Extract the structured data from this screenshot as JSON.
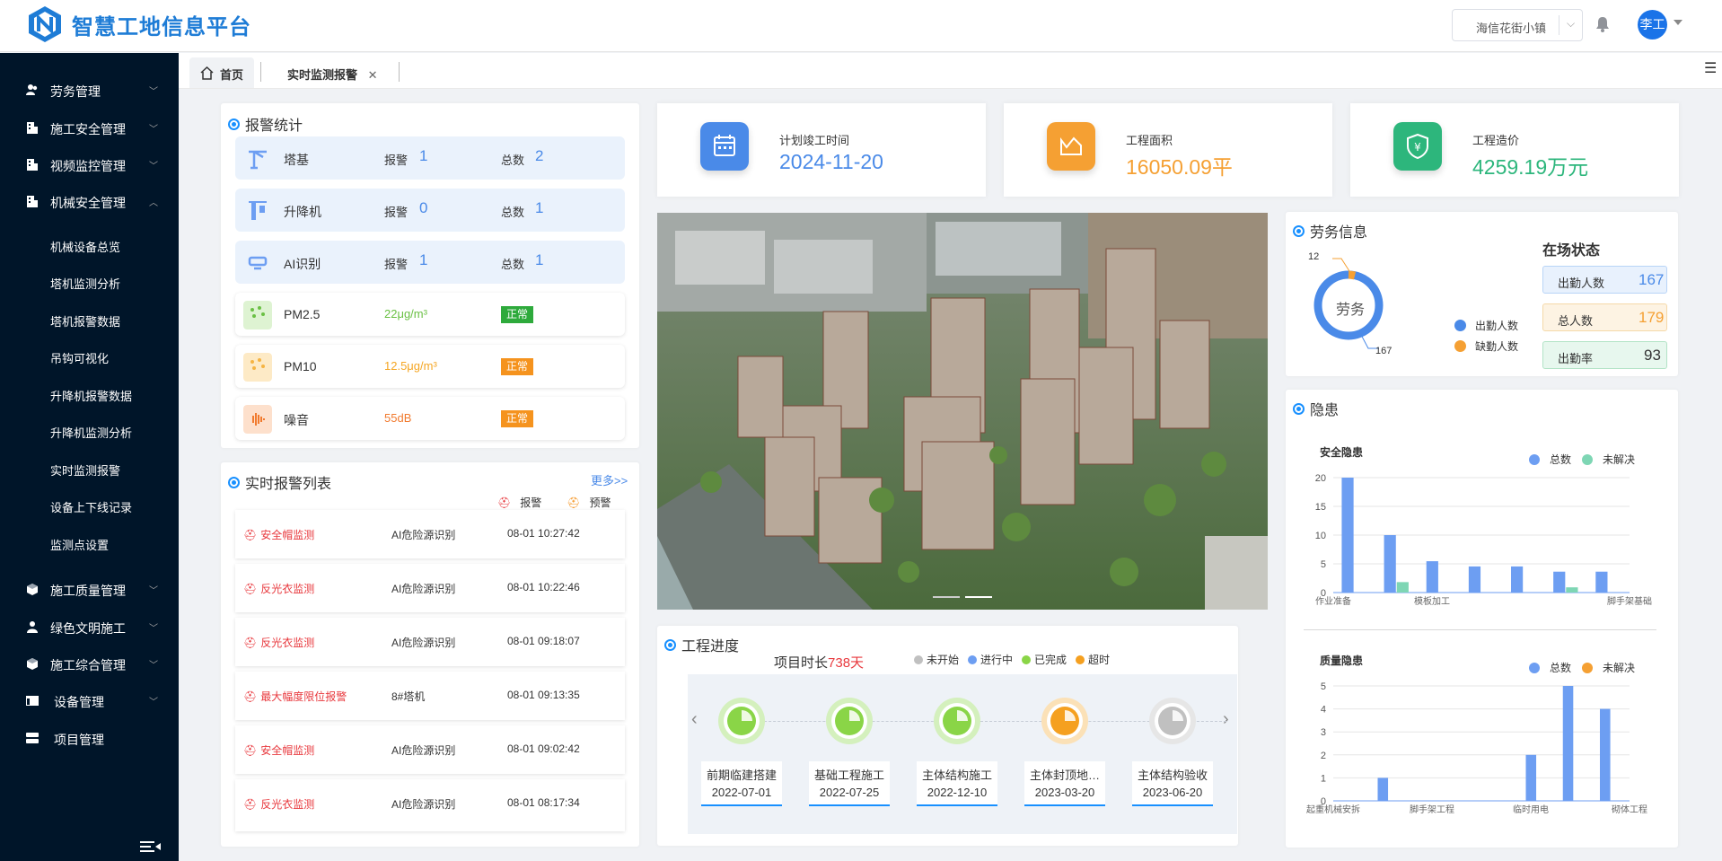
{
  "header": {
    "title": "智慧工地信息平台",
    "site": "海信花街小镇",
    "user": "李工"
  },
  "sidebar": {
    "items": [
      {
        "label": "劳务管理"
      },
      {
        "label": "施工安全管理"
      },
      {
        "label": "视频监控管理"
      },
      {
        "label": "机械安全管理"
      },
      {
        "label": "施工质量管理"
      },
      {
        "label": "绿色文明施工"
      },
      {
        "label": "施工综合管理"
      },
      {
        "label": "设备管理"
      },
      {
        "label": "项目管理"
      }
    ],
    "sub": [
      "机械设备总览",
      "塔机监测分析",
      "塔机报警数据",
      "吊钩可视化",
      "升降机报警数据",
      "升降机监测分析",
      "实时监测报警",
      "设备上下线记录",
      "监测点设置"
    ]
  },
  "tabs": {
    "home": "首页",
    "active": "实时监测报警"
  },
  "alarm_stats": {
    "title": "报警统计",
    "alarm_key": "报警",
    "total_key": "总数",
    "rows": [
      {
        "name": "塔基",
        "alarm": "1",
        "total": "2"
      },
      {
        "name": "升降机",
        "alarm": "0",
        "total": "1"
      },
      {
        "name": "AI识别",
        "alarm": "1",
        "total": "1"
      }
    ],
    "env": [
      {
        "name": "PM2.5",
        "value": "22μg/m³",
        "status": "正常",
        "color": "#6ac044",
        "badge": "#2eaa3c"
      },
      {
        "name": "PM10",
        "value": "12.5μg/m³",
        "status": "正常",
        "color": "#f5a623",
        "badge": "#f5931e"
      },
      {
        "name": "噪音",
        "value": "55dB",
        "status": "正常",
        "color": "#f17a2e",
        "badge": "#f5931e"
      }
    ]
  },
  "alarm_list": {
    "title": "实时报警列表",
    "more": "更多>>",
    "legend_alarm": "报警",
    "legend_warn": "预警",
    "rows": [
      {
        "type": "安全帽监测",
        "source": "AI危险源识别",
        "time": "08-01 10:27:42"
      },
      {
        "type": "反光衣监测",
        "source": "AI危险源识别",
        "time": "08-01 10:22:46"
      },
      {
        "type": "反光衣监测",
        "source": "AI危险源识别",
        "time": "08-01 09:18:07"
      },
      {
        "type": "最大幅度限位报警",
        "source": "8#塔机",
        "time": "08-01 09:13:35"
      },
      {
        "type": "安全帽监测",
        "source": "AI危险源识别",
        "time": "08-01 09:02:42"
      },
      {
        "type": "反光衣监测",
        "source": "AI危险源识别",
        "time": "08-01 08:17:34"
      }
    ]
  },
  "stats": [
    {
      "label": "计划竣工时间",
      "value": "2024-11-20",
      "color": "#4a8ae8"
    },
    {
      "label": "工程面积",
      "value": "16050.09平",
      "color": "#f5a033"
    },
    {
      "label": "工程造价",
      "value": "4259.19万元",
      "color": "#2db67c"
    }
  ],
  "progress": {
    "title": "工程进度",
    "duration_label": "项目时长",
    "duration_value": "738天",
    "legend": [
      {
        "label": "未开始",
        "color": "#c0c0c0"
      },
      {
        "label": "进行中",
        "color": "#6d9ef2"
      },
      {
        "label": "已完成",
        "color": "#8ad547"
      },
      {
        "label": "超时",
        "color": "#f5a020"
      }
    ],
    "steps": [
      {
        "name": "前期临建搭建",
        "date": "2022-07-01",
        "state": "done"
      },
      {
        "name": "基础工程施工",
        "date": "2022-07-25",
        "state": "done"
      },
      {
        "name": "主体结构施工",
        "date": "2022-12-10",
        "state": "done"
      },
      {
        "name": "主体封顶地…",
        "date": "2023-03-20",
        "state": "overdue"
      },
      {
        "name": "主体结构验收",
        "date": "2023-06-20",
        "state": "pending"
      }
    ]
  },
  "labor": {
    "title": "劳务信息",
    "center": "劳务",
    "label_top": "12",
    "label_bottom": "167",
    "legend": [
      {
        "label": "出勤人数",
        "color": "#4a8ae8"
      },
      {
        "label": "缺勤人数",
        "color": "#f5a033"
      }
    ],
    "status_title": "在场状态",
    "status": [
      {
        "label": "出勤人数",
        "value": "167",
        "bg": "#e8f1fd",
        "border": "#b8d4f7",
        "color": "#4a8ae8"
      },
      {
        "label": "总人数",
        "value": "179",
        "bg": "#fdf3e3",
        "border": "#f5d9a8",
        "color": "#f5a033"
      },
      {
        "label": "出勤率",
        "value": "93",
        "bg": "#e7f7ee",
        "border": "#b2e3c6",
        "color": "#333"
      }
    ]
  },
  "hazard": {
    "title": "隐患"
  },
  "chart_data": [
    {
      "type": "bar",
      "title": "安全隐患",
      "categories": [
        "作业准备",
        "",
        "模板加工",
        "",
        "",
        "",
        "脚手架基础"
      ],
      "series": [
        {
          "name": "总数",
          "color": "#6d9ef2",
          "values": [
            22,
            11,
            6,
            5,
            5,
            4,
            4
          ]
        },
        {
          "name": "未解决",
          "color": "#7ed6b4",
          "values": [
            0,
            2,
            0,
            0,
            0,
            1,
            0
          ]
        }
      ],
      "yticks": [
        "0",
        "5",
        "10",
        "15",
        "20"
      ],
      "ylim": [
        0,
        22
      ]
    },
    {
      "type": "bar",
      "title": "质量隐患",
      "categories": [
        "起重机械安拆",
        "",
        "脚手架工程",
        "",
        "临时用电",
        "",
        "砌体工程"
      ],
      "series": [
        {
          "name": "总数",
          "color": "#6d9ef2",
          "values": [
            0,
            1,
            0,
            0,
            0,
            2,
            5,
            4
          ]
        },
        {
          "name": "未解决",
          "color": "#f5a033",
          "values": [
            0,
            0,
            0,
            0,
            0,
            0,
            0,
            0
          ]
        }
      ],
      "yticks": [
        "0",
        "1",
        "2",
        "3",
        "4",
        "5"
      ],
      "ylim": [
        0,
        5
      ]
    }
  ]
}
